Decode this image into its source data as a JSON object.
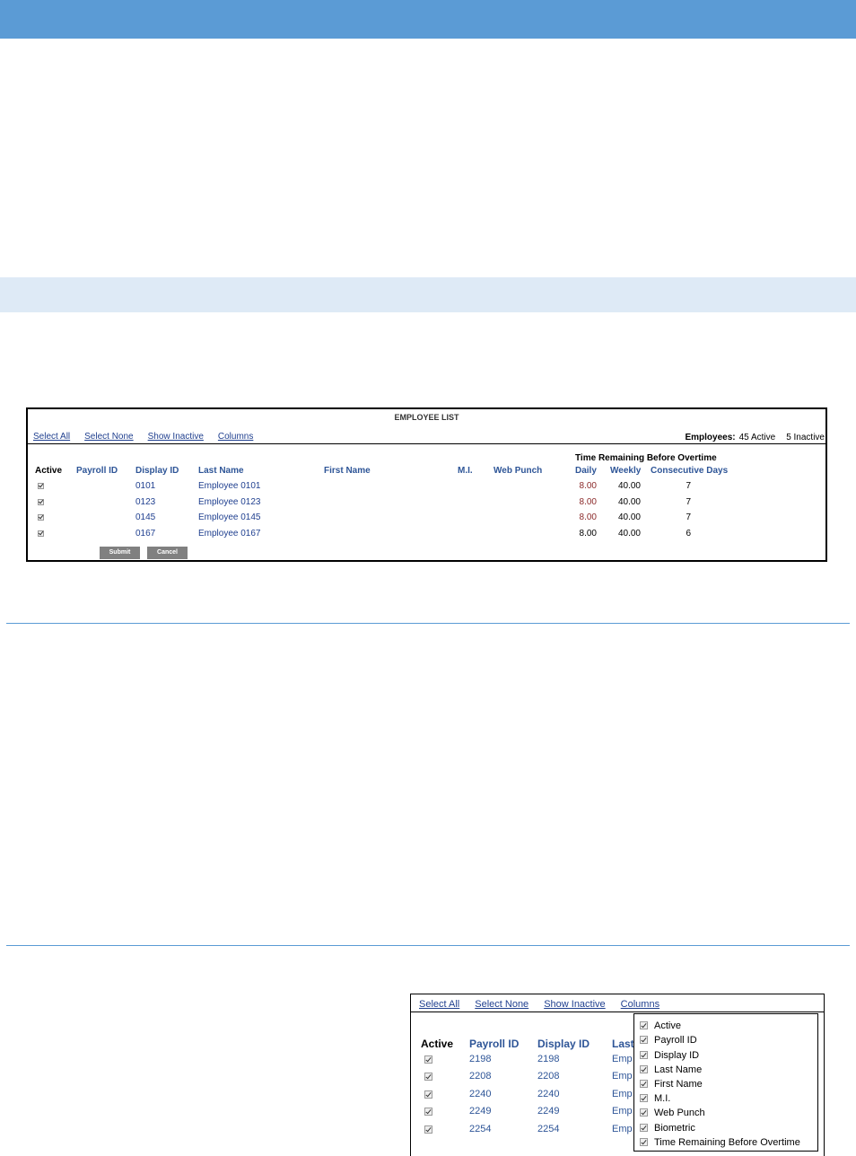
{
  "colors": {
    "header_blue": "#5b9bd5",
    "subheader_blue": "#deeaf6",
    "link_blue": "#1f3f8f",
    "header_text_blue": "#2e5597"
  },
  "panel1": {
    "title": "EMPLOYEE LIST",
    "links": [
      "Select All",
      "Select None",
      "Show Inactive",
      "Columns"
    ],
    "employees_label": "Employees:",
    "active_count": "45 Active",
    "inactive_count": "5 Inactive",
    "overtime_header": "Time Remaining Before Overtime",
    "columns": {
      "active": "Active",
      "payroll_id": "Payroll ID",
      "display_id": "Display ID",
      "last_name": "Last Name",
      "first_name": "First Name",
      "mi": "M.I.",
      "web_punch": "Web Punch",
      "daily": "Daily",
      "weekly": "Weekly",
      "consecutive_days": "Consecutive Days"
    },
    "rows": [
      {
        "active": true,
        "display_id": "0101",
        "last_name": "Employee 0101",
        "daily": "8.00",
        "weekly": "40.00",
        "consecutive_days": "7"
      },
      {
        "active": true,
        "display_id": "0123",
        "last_name": "Employee 0123",
        "daily": "8.00",
        "weekly": "40.00",
        "consecutive_days": "7"
      },
      {
        "active": true,
        "display_id": "0145",
        "last_name": "Employee 0145",
        "daily": "8.00",
        "weekly": "40.00",
        "consecutive_days": "7"
      },
      {
        "active": true,
        "display_id": "0167",
        "last_name": "Employee 0167",
        "daily": "8.00",
        "weekly": "40.00",
        "consecutive_days": "6"
      }
    ],
    "submit_label": "Submit",
    "cancel_label": "Cancel"
  },
  "panel2": {
    "links": [
      "Select All",
      "Select None",
      "Show Inactive",
      "Columns"
    ],
    "columns": {
      "active": "Active",
      "payroll_id": "Payroll ID",
      "display_id": "Display ID",
      "last_name_partial": "Last"
    },
    "rows": [
      {
        "active": true,
        "payroll_id": "2198",
        "display_id": "2198",
        "last_name_partial": "Emp"
      },
      {
        "active": true,
        "payroll_id": "2208",
        "display_id": "2208",
        "last_name_partial": "Emp"
      },
      {
        "active": true,
        "payroll_id": "2240",
        "display_id": "2240",
        "last_name_partial": "Emp"
      },
      {
        "active": true,
        "payroll_id": "2249",
        "display_id": "2249",
        "last_name_partial": "Emp"
      },
      {
        "active": true,
        "payroll_id": "2254",
        "display_id": "2254",
        "last_name_partial": "Emp"
      }
    ],
    "columns_menu": [
      "Active",
      "Payroll ID",
      "Display ID",
      "Last Name",
      "First Name",
      "M.I.",
      "Web Punch",
      "Biometric",
      "Time Remaining Before Overtime"
    ]
  }
}
